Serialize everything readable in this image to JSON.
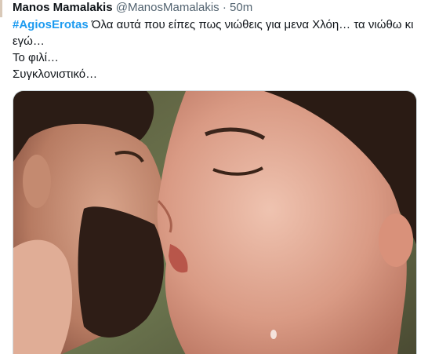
{
  "tweet": {
    "author_name": "Manos Mamalakis",
    "author_handle": "@ManosMamalakis",
    "separator": "·",
    "timestamp": "50m",
    "hashtag": "#AgiosErotas",
    "text_line1": " Όλα αυτά που είπες πως νιώθεις για μενα Χλόη… τα νιώθω κι",
    "text_line2": "εγώ…",
    "text_line3": "Το φιλί…",
    "text_line4": "Συγκλονιστικό…"
  },
  "colors": {
    "hashtag": "#1d9bf0",
    "text": "#0f1419",
    "muted": "#536471",
    "border": "#cfd9de"
  }
}
